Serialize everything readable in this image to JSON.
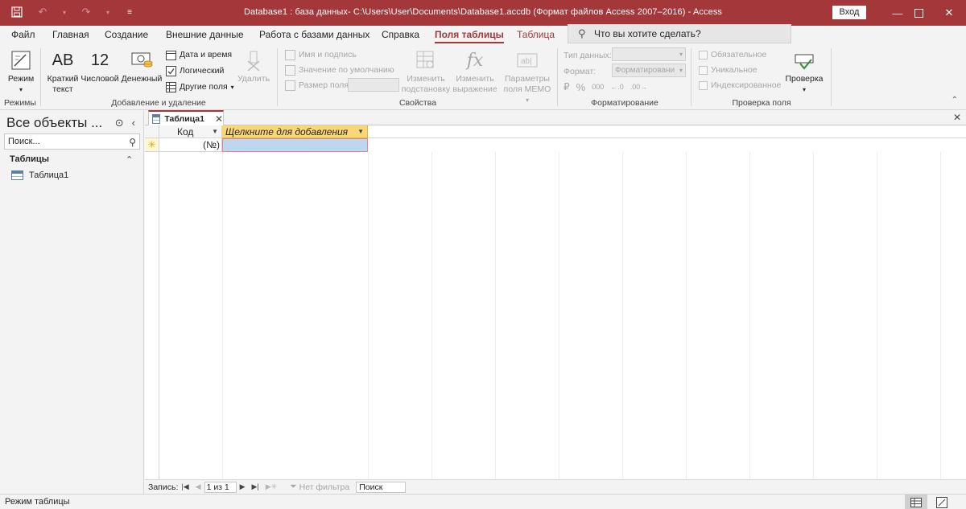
{
  "window": {
    "title": "Database1 : база данных- C:\\Users\\User\\Documents\\Database1.accdb (Формат файлов Access 2007–2016)  -  Access",
    "signin_label": "Вход",
    "accent_color": "#a4373a"
  },
  "tabs": {
    "file": "Файл",
    "home": "Главная",
    "create": "Создание",
    "external": "Внешние данные",
    "dbtools": "Работа с базами данных",
    "help": "Справка",
    "fields": "Поля таблицы",
    "table": "Таблица"
  },
  "tellme": {
    "placeholder": "Что вы хотите сделать?"
  },
  "ribbon": {
    "views": {
      "mode_label": "Режим",
      "group_label": "Режимы"
    },
    "add_delete": {
      "short_text_icon": "AB",
      "short_text_label": "Краткий текст",
      "number_icon": "12",
      "number_label": "Числовой",
      "currency_label": "Денежный",
      "datetime_label": "Дата и время",
      "logical_label": "Логический",
      "other_fields_label": "Другие поля",
      "delete_label": "Удалить",
      "group_label": "Добавление и удаление"
    },
    "properties": {
      "name_caption_label": "Имя и подпись",
      "default_value_label": "Значение по умолчанию",
      "field_size_label": "Размер поля",
      "modify_lookups_label": "Изменить подстановку",
      "modify_expression_label": "Изменить выражение",
      "memo_settings_label": "Параметры поля MEMO",
      "group_label": "Свойства"
    },
    "formatting": {
      "data_type_label": "Тип данных:",
      "format_label": "Формат:",
      "format_value": "Форматировани",
      "percent_symbol": "%",
      "thousands_symbol": "000",
      "group_label": "Форматирование"
    },
    "validation": {
      "required_label": "Обязательное",
      "unique_label": "Уникальное",
      "indexed_label": "Индексированное",
      "validation_label": "Проверка",
      "group_label": "Проверка поля"
    }
  },
  "navpane": {
    "title": "Все объекты ...",
    "search_placeholder": "Поиск...",
    "group_label": "Таблицы",
    "items": [
      {
        "label": "Таблица1"
      }
    ]
  },
  "document": {
    "tab_label": "Таблица1",
    "columns": [
      {
        "label": "Код"
      },
      {
        "label": "Щелкните для добавления"
      }
    ],
    "new_row": {
      "id_cell": "(№)"
    }
  },
  "record_nav": {
    "label": "Запись:",
    "position": "1 из 1",
    "filter_label": "Нет фильтра",
    "search_label": "Поиск"
  },
  "status": {
    "text": "Режим таблицы"
  }
}
